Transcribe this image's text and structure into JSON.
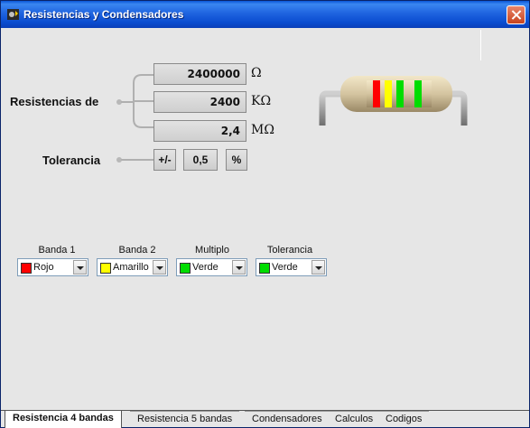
{
  "window": {
    "title": "Resistencias y Condensadores"
  },
  "resistance": {
    "label": "Resistencias de",
    "ohms_value": "2400000",
    "ohms_unit": "Ω",
    "kohms_value": "2400",
    "kohms_unit": "KΩ",
    "mohms_value": "2,4",
    "mohms_unit": "MΩ"
  },
  "tolerance": {
    "label": "Tolerancia",
    "plusminus": "+/-",
    "value": "0,5",
    "percent": "%"
  },
  "bands": [
    {
      "label": "Banda 1",
      "selected": "Rojo",
      "color": "#ff0000"
    },
    {
      "label": "Banda 2",
      "selected": "Amarillo",
      "color": "#ffff00"
    },
    {
      "label": "Multiplo",
      "selected": "Verde",
      "color": "#00dd00"
    },
    {
      "label": "Tolerancia",
      "selected": "Verde",
      "color": "#00dd00"
    }
  ],
  "resistor_colors": [
    "#ff0000",
    "#ffff00",
    "#00dd00",
    "#00dd00"
  ],
  "tabs": [
    "Resistencia 4 bandas",
    "Resistencia 5 bandas",
    "Condensadores",
    "Calculos",
    "Codigos"
  ],
  "active_tab": "Resistencia 4 bandas"
}
